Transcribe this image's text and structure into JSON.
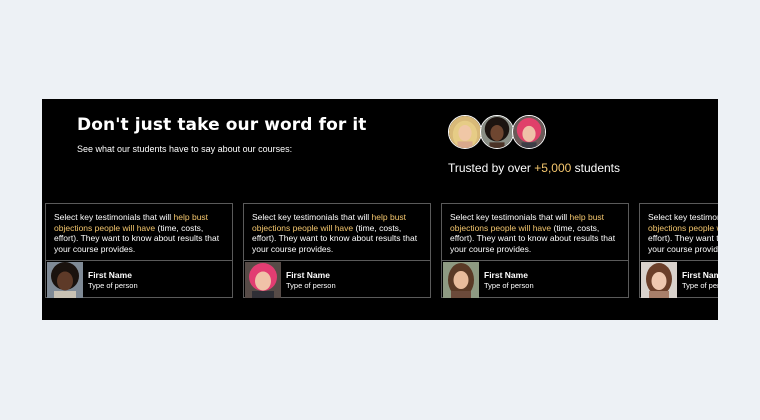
{
  "section": {
    "heading": "Don't just take our word for it",
    "subheading": "See what our students have to say about our courses:"
  },
  "trust": {
    "prefix": "Trusted by over ",
    "count": "+5,000",
    "suffix": " students",
    "avatars": [
      "blonde-woman-avatar",
      "curly-haired-woman-avatar",
      "pink-haired-woman-avatar"
    ]
  },
  "testimonials": [
    {
      "quote_before": "Select key testimonials that will ",
      "quote_highlight": "help bust objections people will have",
      "quote_after": " (time, costs, effort). They want to know about results that your course provides.",
      "name": "First Name",
      "role": "Type of person",
      "photo": "curly-haired-woman-photo"
    },
    {
      "quote_before": "Select key testimonials that will ",
      "quote_highlight": "help bust objections people will have",
      "quote_after": " (time, costs, effort). They want to know about results that your course provides.",
      "name": "First Name",
      "role": "Type of person",
      "photo": "pink-haired-woman-photo"
    },
    {
      "quote_before": "Select key testimonials that will ",
      "quote_highlight": "help bust objections people will have",
      "quote_after": " (time, costs, effort). They want to know about results that your course provides.",
      "name": "First Name",
      "role": "Type of person",
      "photo": "long-haired-woman-photo"
    },
    {
      "quote_before": "Select key testimonials that will ",
      "quote_highlight": "help bust objections people will have",
      "quote_after": " (time, costs, effort). They want to know about results that your course provides.",
      "name": "First Name",
      "role": "Type of person",
      "photo": "brunette-woman-photo"
    }
  ],
  "colors": {
    "page_background": "#edf1f5",
    "panel_background": "#000000",
    "accent": "#f5c76e",
    "border": "#5a5a5a"
  }
}
